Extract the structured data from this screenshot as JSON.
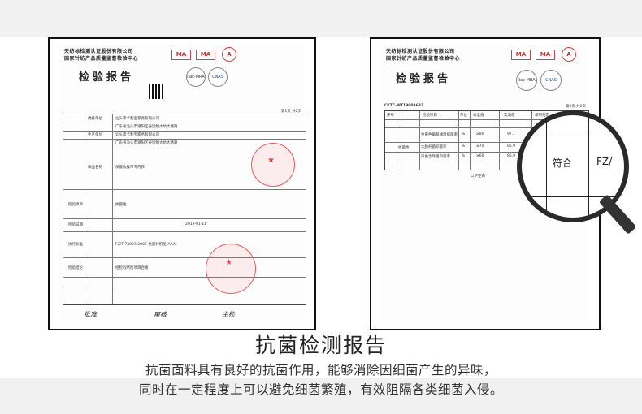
{
  "left_report": {
    "org_line1": "天纺标检测认证股份有限公司",
    "org_line2": "国家针纺产品质量监督检验中心",
    "title": "检验报告",
    "logo_ma": "MA",
    "logo_a": "A",
    "ilac": "ilac-MRA",
    "cnas": "CNAS",
    "page_info": "第1页 共2页",
    "rows": [
      {
        "label": "委托单位",
        "value": "汕头市卡利宝家务有限公司"
      },
      {
        "label": "",
        "value": "广东省汕头市潮阳区谷饶镇大坑大路路"
      },
      {
        "label": "生产单位",
        "value": "汕头市卡利宝家务有限公司"
      },
      {
        "label": "",
        "value": "广东省汕头市潮阳区谷饶镇大坑大路路"
      },
      {
        "label": "样品名称",
        "value": "保健收腹带专内衣"
      },
      {
        "label": "检验项目",
        "value": "抗菌性"
      },
      {
        "label": "检验日期",
        "value": "2019-01-11"
      },
      {
        "label": "执行标准",
        "value": "FZ/T 73023-2006 抗菌针织品(AAA)"
      },
      {
        "label": "检验结论",
        "value": "经检验所检项目合格"
      }
    ],
    "signatures": [
      "批准",
      "审核",
      "主检"
    ]
  },
  "right_report": {
    "org_line1": "天纺标检测认证股份有限公司",
    "org_line2": "国家针纺产品质量监督检验中心",
    "title": "检验报告",
    "logo_ma": "MA",
    "logo_a": "A",
    "ilac": "ilac-MRA",
    "cnas": "CNAS",
    "report_no": "CKTC-WT19003632",
    "page_info": "第2页 共2页",
    "headers": [
      "序号",
      "检验项目",
      "单位",
      "标准值",
      "实测值",
      "单项判定"
    ],
    "rows": [
      {
        "item": "金黄色葡萄球菌抑菌率",
        "unit": "%",
        "std": "≥80",
        "val": "97.1"
      },
      {
        "item": "大肠杆菌抑菌率",
        "unit": "%",
        "std": "≥70",
        "val": "85.9"
      },
      {
        "item": "白色念珠菌抑菌率",
        "unit": "%",
        "std": "≥60",
        "val": "85.9"
      }
    ],
    "category": "抗菌性",
    "footer": "以下空白"
  },
  "magnifier": {
    "text_main": "符合",
    "text_side": "FZ/"
  },
  "heading": "抗菌检测报告",
  "description_line1": "抗菌面料具有良好的抗菌作用，能够消除因细菌产生的异味，",
  "description_line2": "同时在一定程度上可以避免细菌繁殖，有效阻隔各类细菌入侵。",
  "colors": {
    "stamp": "#e45a5a",
    "logo": "#c33333",
    "text": "#222222"
  }
}
